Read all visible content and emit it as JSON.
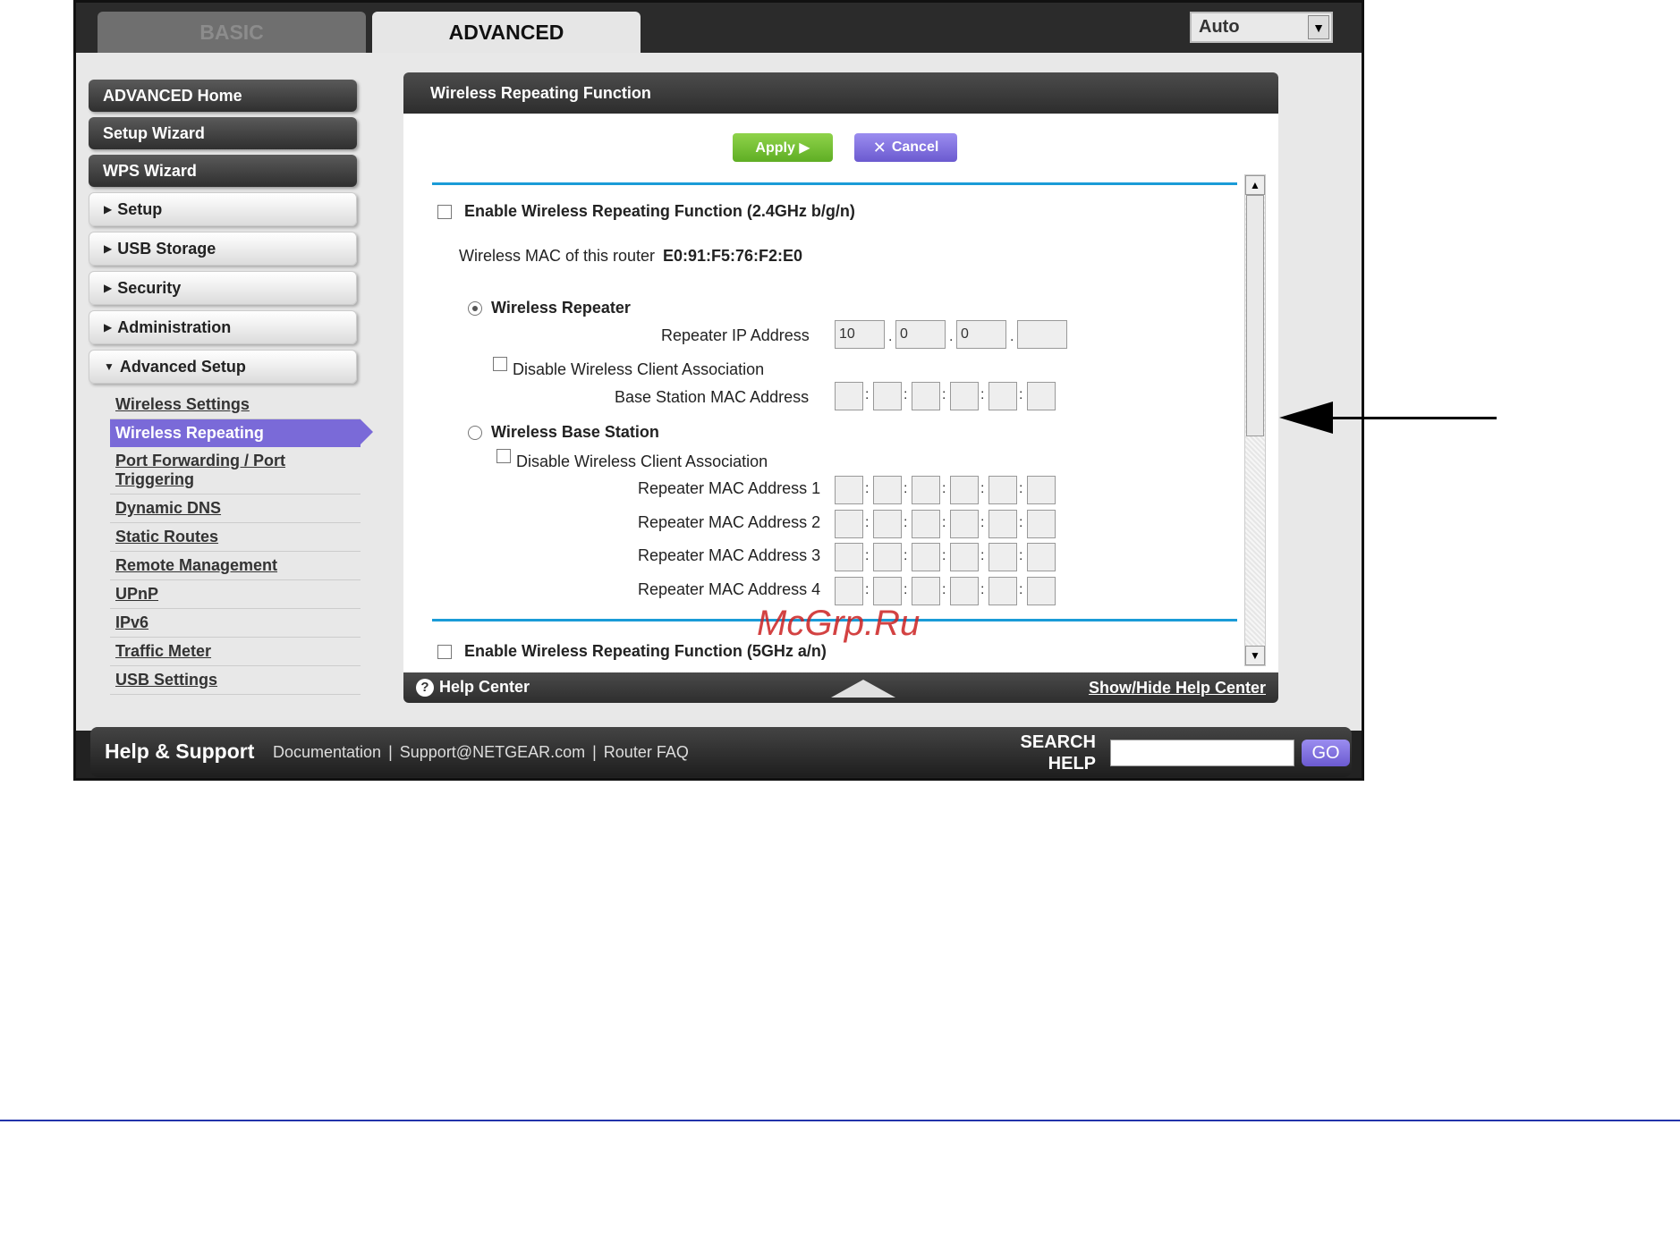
{
  "tabs": {
    "basic": "BASIC",
    "advanced": "ADVANCED"
  },
  "language": {
    "selected": "Auto"
  },
  "sidebar": {
    "top_buttons": [
      "ADVANCED Home",
      "Setup Wizard",
      "WPS Wizard"
    ],
    "sections": [
      "Setup",
      "USB Storage",
      "Security",
      "Administration",
      "Advanced Setup"
    ],
    "subitems": [
      "Wireless Settings",
      "Wireless Repeating",
      "Port Forwarding / Port Triggering",
      "Dynamic DNS",
      "Static Routes",
      "Remote Management",
      "UPnP",
      "IPv6",
      "Traffic Meter",
      "USB Settings"
    ],
    "active_index": 1
  },
  "panel": {
    "title": "Wireless Repeating Function",
    "apply_label": "Apply ▶",
    "cancel_label": "Cancel",
    "enable_24": "Enable Wireless Repeating Function (2.4GHz b/g/n)",
    "mac_label": "Wireless MAC of this router",
    "mac_value": "E0:91:F5:76:F2:E0",
    "repeater_label": "Wireless Repeater",
    "repeater_ip_label": "Repeater IP Address",
    "repeater_ip": [
      "10",
      "0",
      "0",
      ""
    ],
    "disable_assoc_1": "Disable Wireless Client Association",
    "base_mac_label": "Base Station MAC Address",
    "base_station_label": "Wireless Base Station",
    "disable_assoc_2": "Disable Wireless Client Association",
    "repeater_mac_labels": [
      "Repeater MAC Address 1",
      "Repeater MAC Address 2",
      "Repeater MAC Address 3",
      "Repeater MAC Address 4"
    ],
    "enable_5": "Enable Wireless Repeating Function (5GHz a/n)",
    "help_center": "Help Center",
    "show_hide": "Show/Hide Help Center"
  },
  "footer": {
    "title": "Help & Support",
    "links": [
      "Documentation",
      "|",
      "Support@NETGEAR.com",
      "|",
      "Router FAQ"
    ],
    "search_label_1": "SEARCH",
    "search_label_2": "HELP",
    "go_label": "GO"
  },
  "watermark": "McGrp.Ru",
  "colors": {
    "accent": "#1a9bd7",
    "active": "#7a6ad8",
    "apply": "#6fbf2e"
  }
}
